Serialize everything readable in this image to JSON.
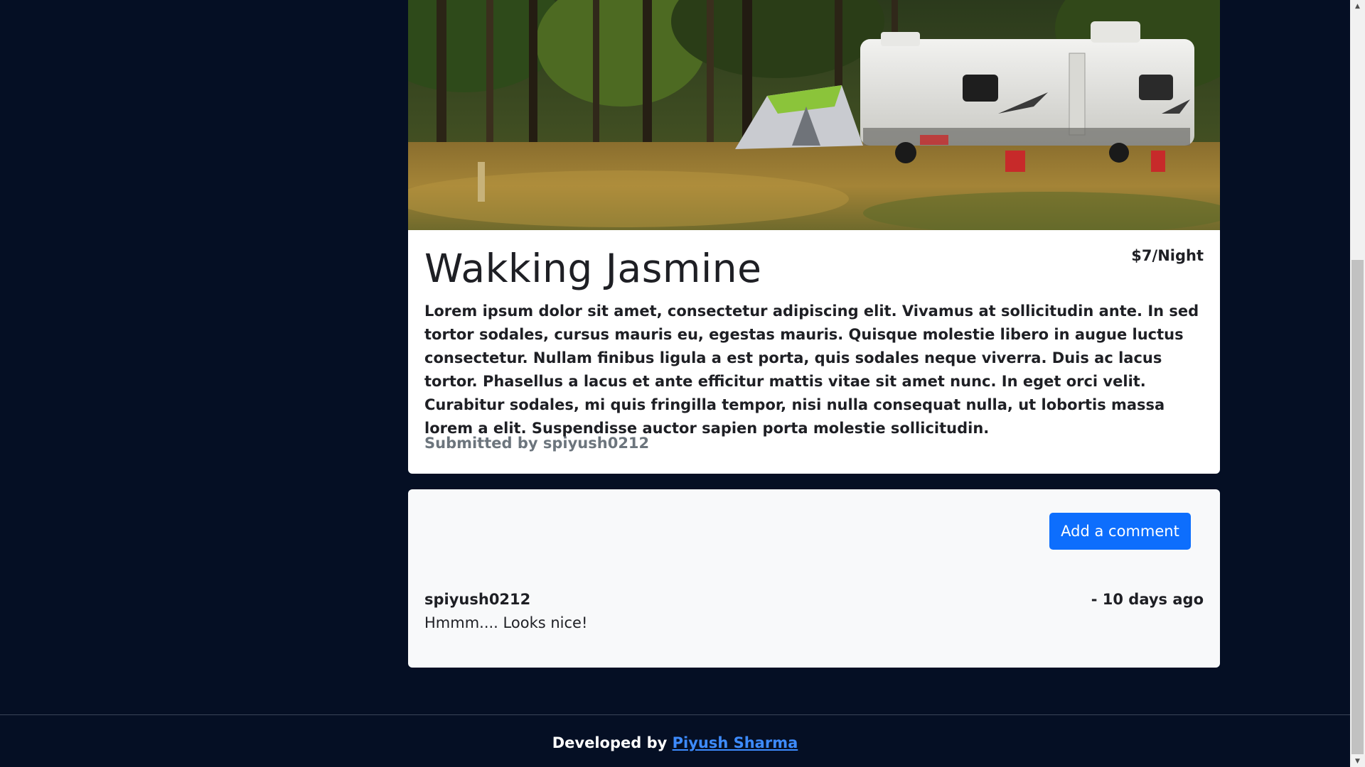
{
  "campground": {
    "title": "Wakking Jasmine",
    "price": "$7/Night",
    "description": "Lorem ipsum dolor sit amet, consectetur adipiscing elit. Vivamus at sollicitudin ante. In sed tortor sodales, cursus mauris eu, egestas mauris. Quisque molestie libero in augue luctus consectetur. Nullam finibus ligula a est porta, quis sodales neque viverra. Duis ac lacus tortor. Phasellus a lacus et ante efficitur mattis vitae sit amet nunc. In eget orci velit. Curabitur sodales, mi quis fringilla tempor, nisi nulla consequat nulla, ut lobortis massa lorem a elit. Suspendisse auctor sapien porta molestie sollicitudin.",
    "submitted_by": "Submitted by spiyush0212"
  },
  "comments": {
    "add_button_label": "Add a comment",
    "items": [
      {
        "author": "spiyush0212",
        "time": "- 10 days ago",
        "text": "Hmmm.... Looks nice!"
      }
    ]
  },
  "footer": {
    "prefix": "Developed by",
    "link_text": "Piyush Sharma"
  },
  "colors": {
    "page_background": "#050f24",
    "primary_button": "#0d6efd",
    "link": "#3d8bfd",
    "muted_text": "#6c757d"
  },
  "icons": {
    "scroll_up": "triangle-up-icon",
    "scroll_down": "triangle-down-icon"
  }
}
